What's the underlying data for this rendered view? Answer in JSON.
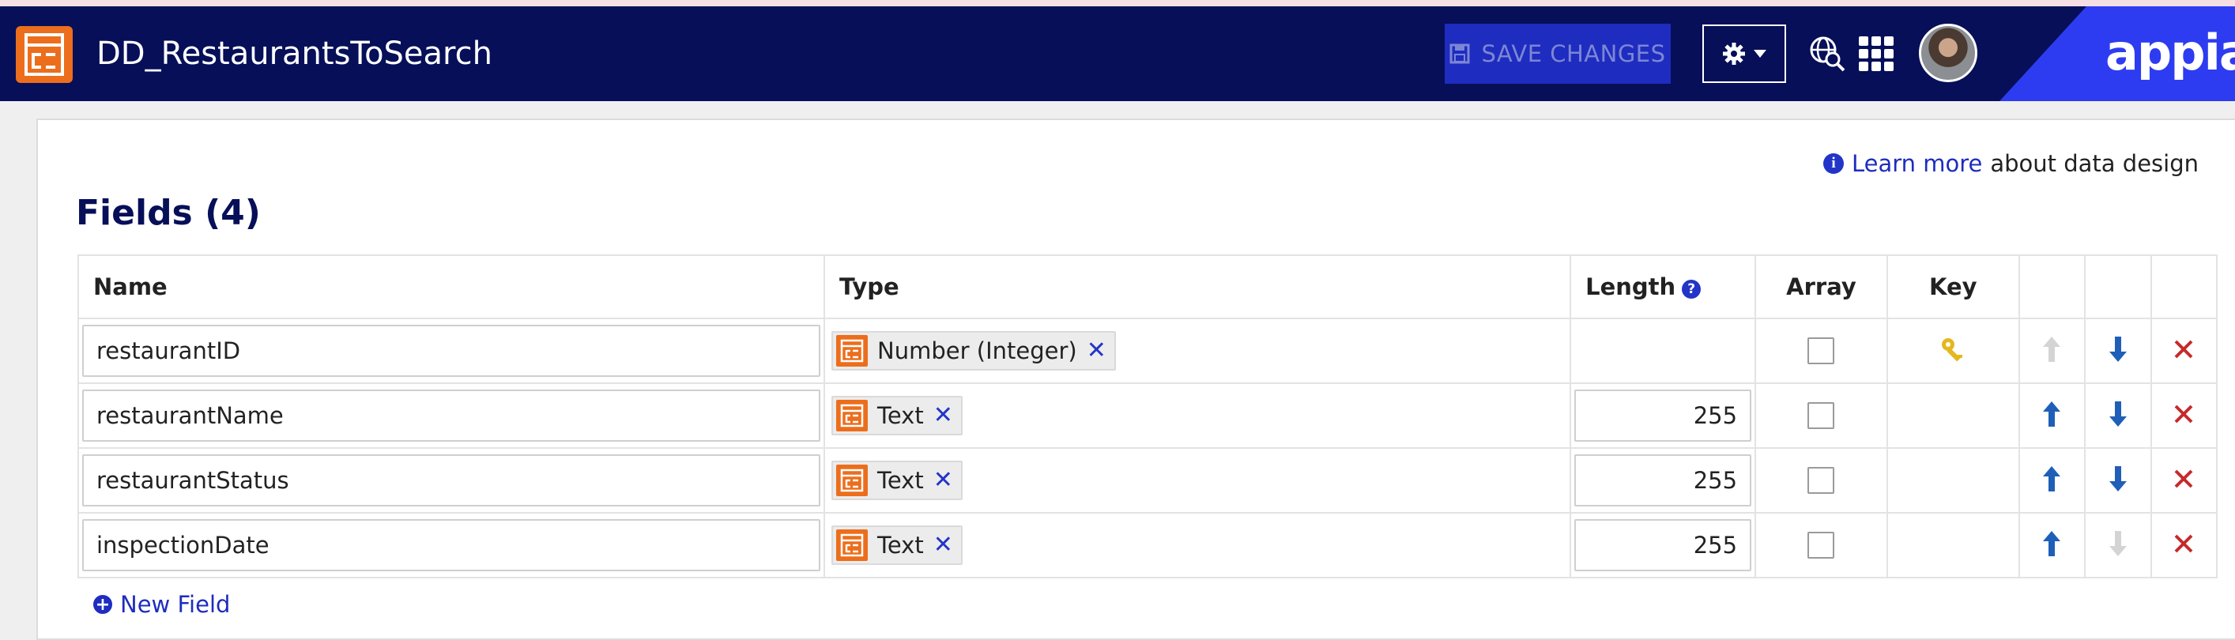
{
  "header": {
    "app_title": "DD_RestaurantsToSearch",
    "app_icon": "data-type-icon",
    "save_label": "SAVE CHANGES",
    "brand": "appian",
    "colors": {
      "header_bg": "#060f58",
      "accent": "#2d3cf0",
      "icon_orange": "#ec6e1c"
    }
  },
  "learn_more": {
    "link": "Learn more",
    "suffix": "about data design"
  },
  "fields": {
    "title": "Fields (4)",
    "columns": {
      "name": "Name",
      "type": "Type",
      "length": "Length",
      "array": "Array",
      "key": "Key"
    },
    "rows": [
      {
        "name": "restaurantID",
        "type": "Number (Integer)",
        "length": "",
        "array": false,
        "key": true,
        "move_up_enabled": false,
        "move_down_enabled": true
      },
      {
        "name": "restaurantName",
        "type": "Text",
        "length": "255",
        "array": false,
        "key": false,
        "move_up_enabled": true,
        "move_down_enabled": true
      },
      {
        "name": "restaurantStatus",
        "type": "Text",
        "length": "255",
        "array": false,
        "key": false,
        "move_up_enabled": true,
        "move_down_enabled": true
      },
      {
        "name": "inspectionDate",
        "type": "Text",
        "length": "255",
        "array": false,
        "key": false,
        "move_up_enabled": true,
        "move_down_enabled": false
      }
    ],
    "new_field_label": "New Field"
  }
}
